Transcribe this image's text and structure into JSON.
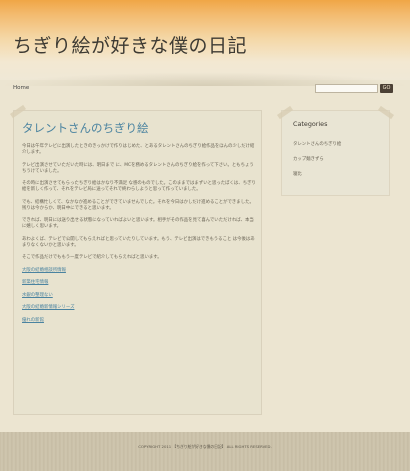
{
  "header": {
    "site_title": "ちぎり絵が好きな僕の日記"
  },
  "nav": {
    "home": "Home",
    "search_button": "GO"
  },
  "post": {
    "title": "タレントさんのちぎり絵",
    "paragraphs": [
      "今日は午年テレビに出演したときのきっかけで作りはじめた、とあるタレントさんのちぎり絵作品をほんの少しだけ紹介します。",
      "テレビ出演させていただいた時には、明日まで に、MCを務めるタレントさんのちぎり絵を作って下さい。ともちょうちうけていました。",
      "その時に出演させてもらったちぎり絵はかなり不満足 な感のものでした。このままではまずいと思ったぼくは、ちぎり絵を新しく作って、それをテレビ局に送ってそれで終わらしようと思って作っていました。",
      "でも、結構忙しくて、なかなか進めることができていませんでした。それを今日はかしだけ進めることができました。残りは今からか、明日中にできると思います。",
      "できれば、明日には送り出せる状態になっていればよいと思います。相手がその作品を見て喜んでいただければ、本当に嬉しく思います。",
      "あわよくば、テレビで公開してもらえればと思っていたりしています。もう、テレビ出演はできもうること は今後はあまりなくないかと思います。",
      "そこで作品だけでももう一度テレビで紹介してもらえればと思います。"
    ],
    "links": [
      "大阪の結婚相談所情報",
      "新築住宅情報",
      "水銀の整理ない",
      "大阪の結婚新情報シリーズ",
      "優れの新館"
    ]
  },
  "sidebar": {
    "title": "Categories",
    "items": [
      "タレントさんのちぎり絵",
      "カップ麺きずら",
      "寝比"
    ]
  },
  "footer": {
    "copyright": "COPYRIGHT 2011 【ちぎり絵が好きな僕の日記】 ALL RIGHTS RESERVED."
  },
  "colors": {
    "link": "#4a83a0",
    "header_orange": "#f0a646"
  }
}
